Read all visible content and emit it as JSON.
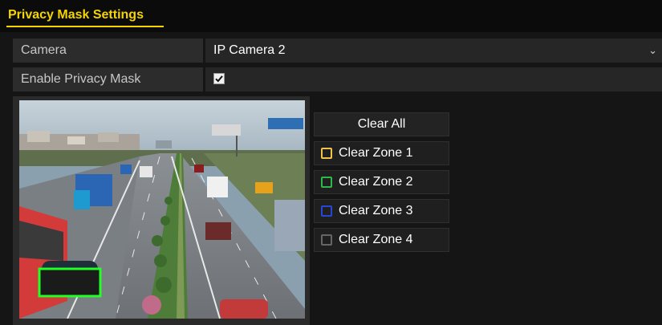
{
  "header": {
    "title": "Privacy Mask Settings"
  },
  "camera": {
    "label": "Camera",
    "value": "IP Camera 2"
  },
  "enable_mask": {
    "label": "Enable Privacy Mask",
    "checked": true
  },
  "buttons": {
    "clear_all": "Clear All",
    "zones": [
      {
        "label": "Clear Zone 1",
        "color": "#f0c24a"
      },
      {
        "label": "Clear Zone 2",
        "color": "#2db84a"
      },
      {
        "label": "Clear Zone 3",
        "color": "#2746d6"
      },
      {
        "label": "Clear Zone 4",
        "color": "#666666"
      }
    ]
  },
  "mask_zone_color": "#22ff22"
}
